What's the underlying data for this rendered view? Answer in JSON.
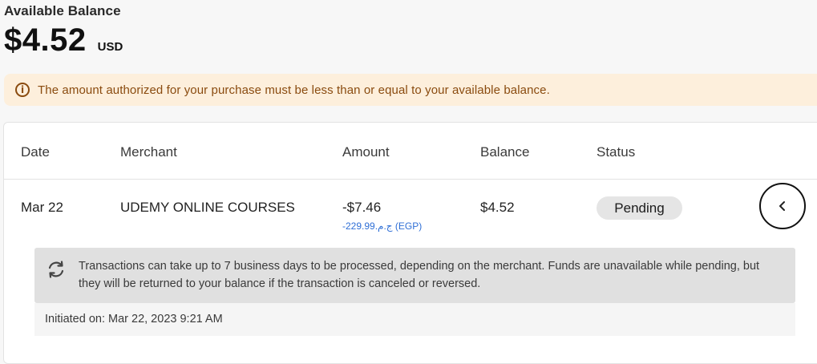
{
  "balance": {
    "label": "Available Balance",
    "amount": "$4.52",
    "currency": "USD"
  },
  "alert": {
    "icon": "info-circle-icon",
    "message": "The amount authorized for your purchase must be less than or equal to your available balance."
  },
  "table": {
    "headers": {
      "date": "Date",
      "merchant": "Merchant",
      "amount": "Amount",
      "balance": "Balance",
      "status": "Status"
    },
    "rows": [
      {
        "date": "Mar 22",
        "merchant": "UDEMY ONLINE COURSES",
        "amount": "-$7.46",
        "amount_local": "-229.99ج.م.‏ (EGP)",
        "balance": "$4.52",
        "status": "Pending",
        "expand_icon": "chevron-left-icon",
        "details": {
          "sync_icon": "sync-icon",
          "message": "Transactions can take up to 7 business days to be processed, depending on the merchant. Funds are unavailable while pending, but they will be returned to your balance if the transaction is canceled or reversed.",
          "initiated": "Initiated on: Mar 22, 2023 9:21 AM"
        }
      }
    ]
  },
  "colors": {
    "alert_bg": "#fdefdc",
    "alert_text": "#8a4b0f",
    "local_amount": "#2f6fd6",
    "status_bg": "#e5e5e5"
  }
}
